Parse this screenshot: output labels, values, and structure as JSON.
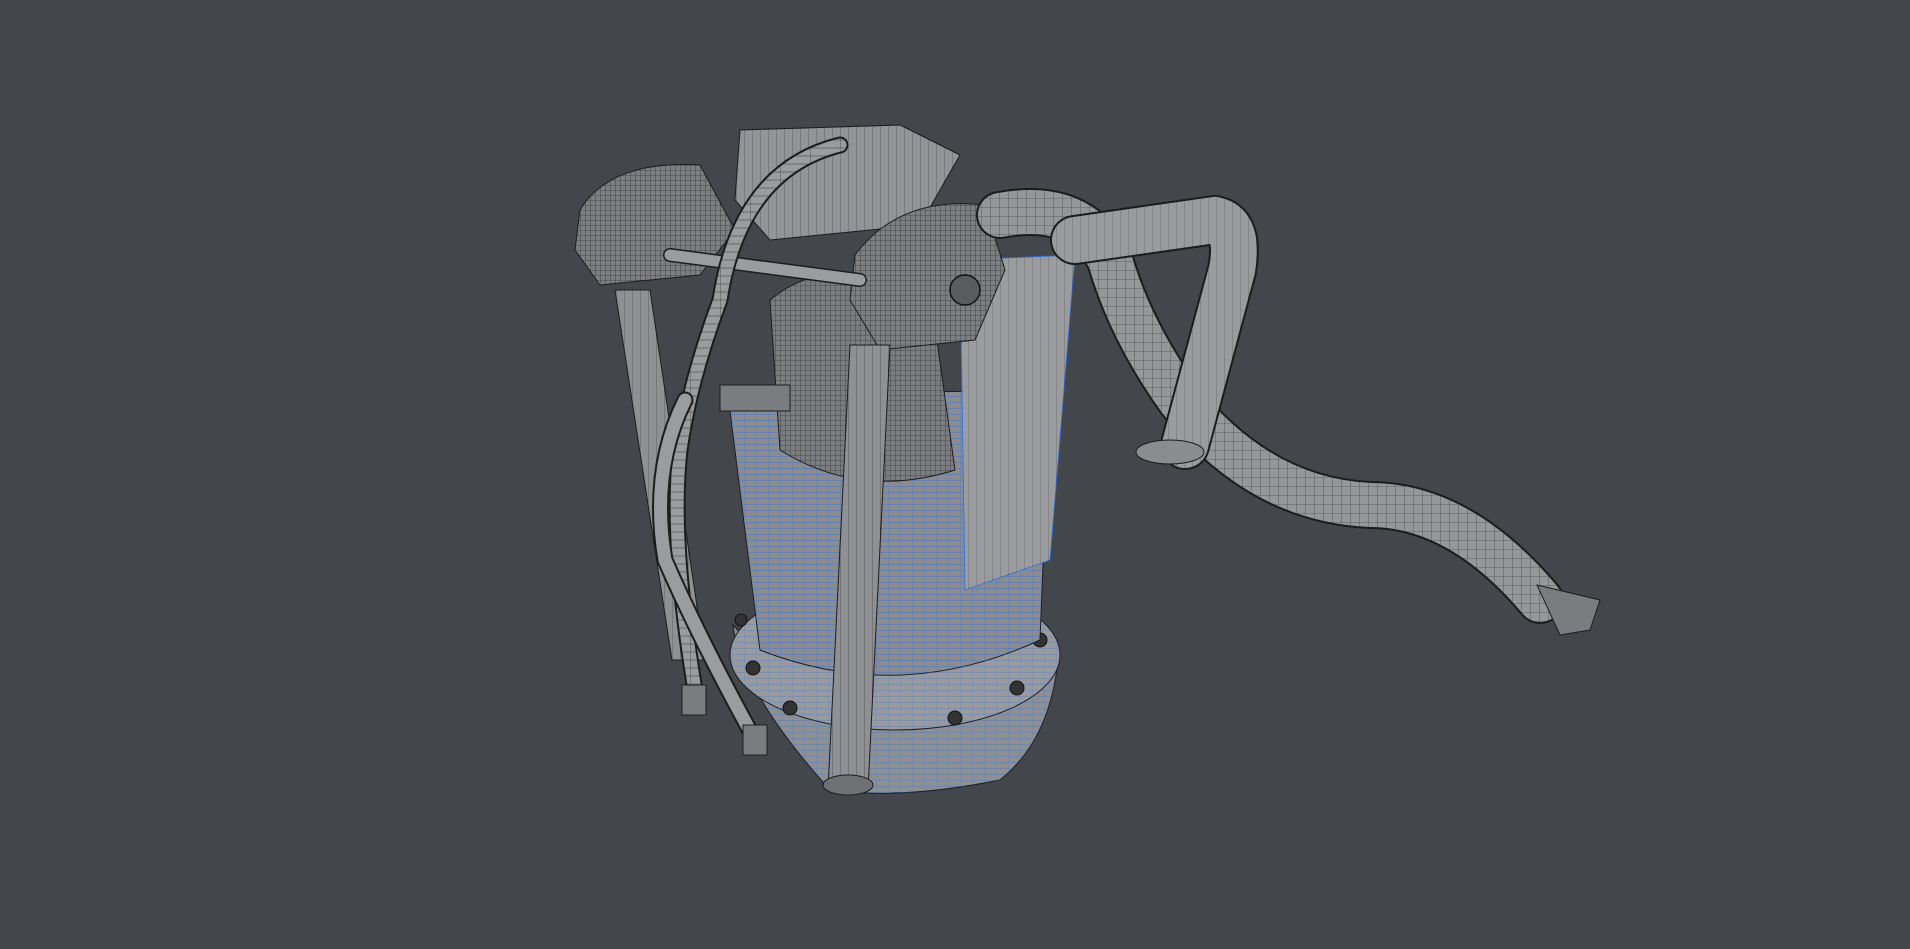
{
  "viewport": {
    "background_color": "#43474b",
    "display_mode": "wireframe-on-shaded",
    "object": {
      "name": "",
      "type": "mechanical-assembly",
      "surface_color": "#8c8e90",
      "wire_color": "#1c1c1c",
      "selected_wire_color": "#2f6fe0"
    }
  }
}
